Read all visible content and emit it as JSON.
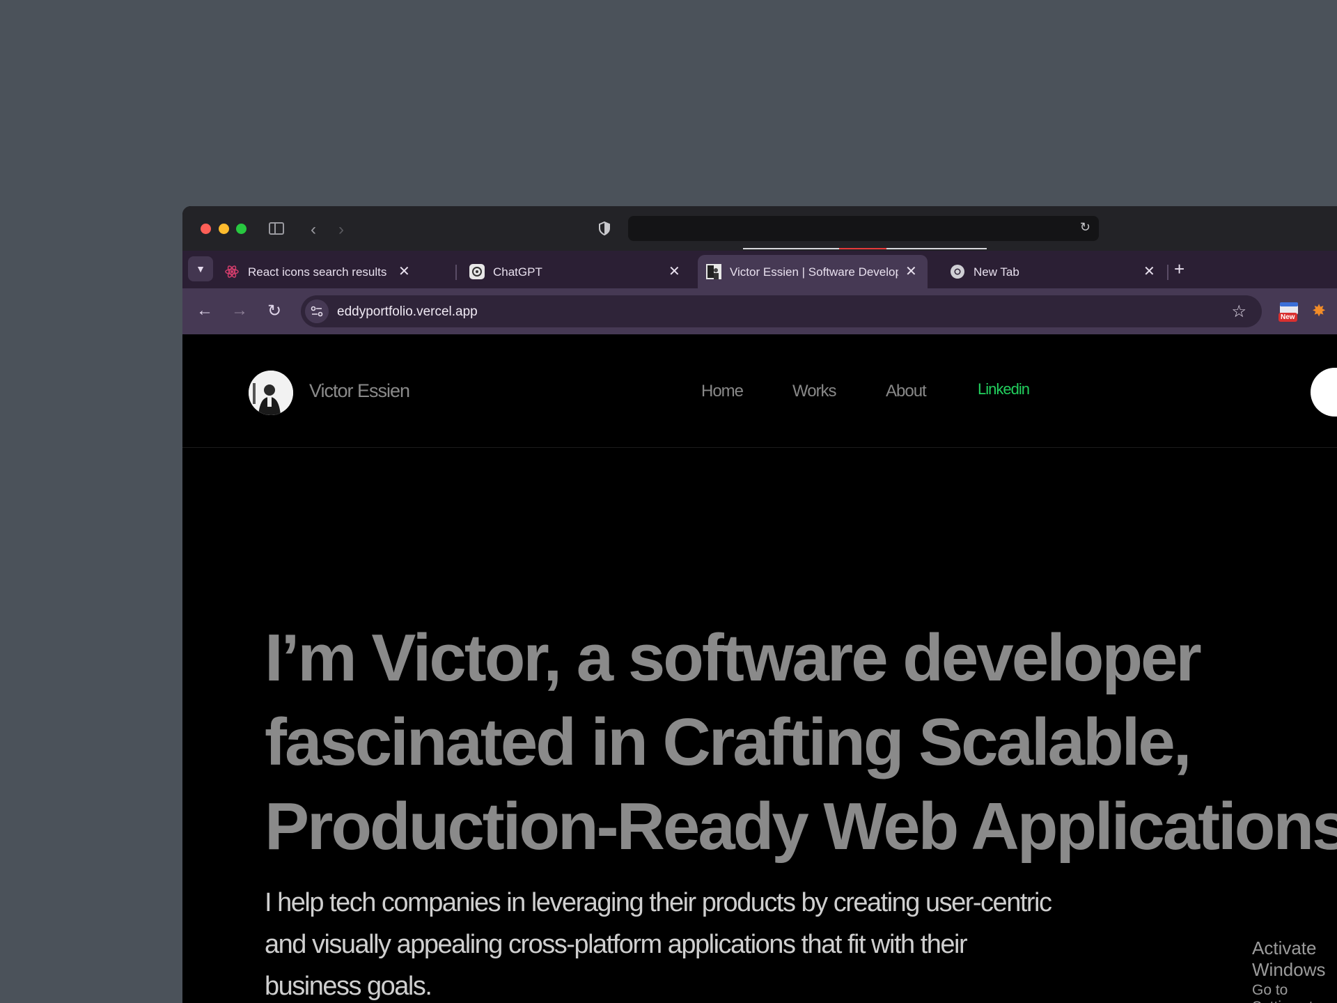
{
  "browser": {
    "tabs": [
      {
        "label": "React icons search results",
        "favicon": "react-icon"
      },
      {
        "label": "ChatGPT",
        "favicon": "chatgpt-icon"
      },
      {
        "label": "Victor Essien | Software Develop",
        "favicon": "portrait-icon",
        "active": true
      },
      {
        "label": "New Tab",
        "favicon": "chrome-icon"
      }
    ],
    "url": "eddyportfolio.vercel.app",
    "extension_badge": "New"
  },
  "site": {
    "brand": "Victor Essien",
    "nav": {
      "home": "Home",
      "works": "Works",
      "about": "About",
      "linkedin": "Linkedin"
    },
    "hero": {
      "line1": "I’m Victor, a software developer",
      "line2": "fascinated in Crafting Scalable,",
      "line3": "Production-Ready Web Applications",
      "subtitle": "I help tech companies in leveraging their products by creating user-centric and visually appealing cross-platform applications that fit with their business goals."
    },
    "colors": {
      "accent": "#22d05e",
      "background": "#000000",
      "tabstrip": "#2b1f34"
    }
  },
  "os_watermark": {
    "line1": "Activate Windows",
    "line2": "Go to Settings to activate Windows."
  }
}
